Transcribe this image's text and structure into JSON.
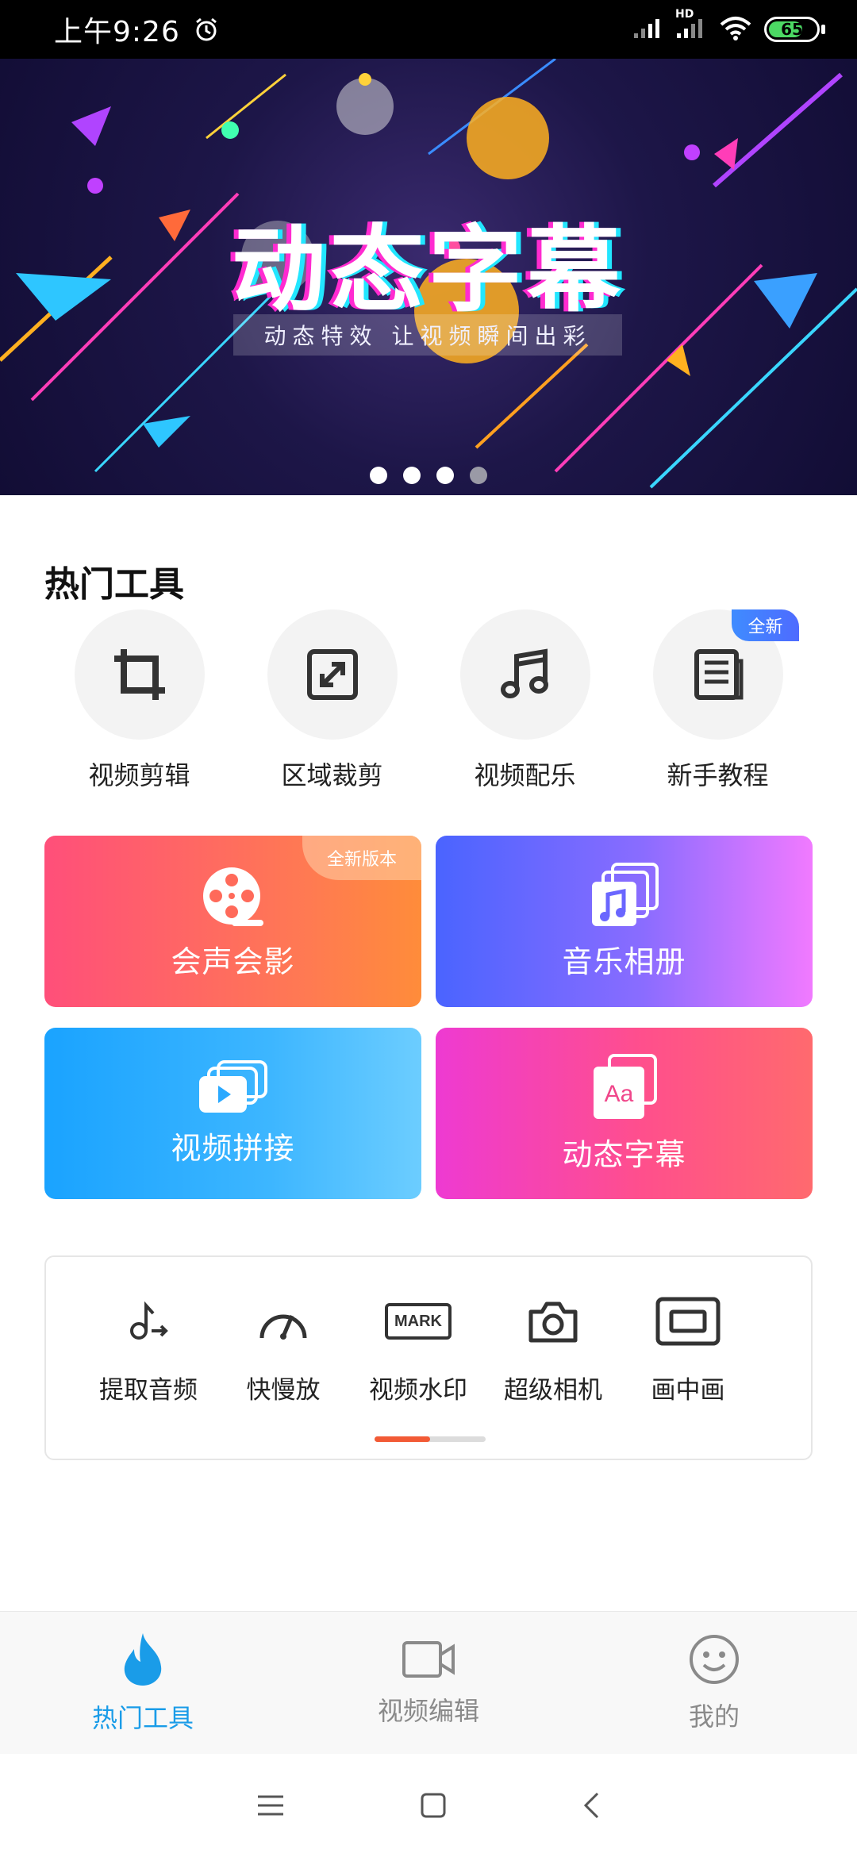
{
  "status_bar": {
    "time": "上午9:26",
    "network_label": "HD",
    "battery": "65"
  },
  "banner": {
    "title": "动态字幕",
    "subtitle": "动态特效 让视频瞬间出彩",
    "dots_total": 4,
    "active_dot": 1
  },
  "hot_tools": {
    "title": "热门工具",
    "items": [
      {
        "label": "视频剪辑",
        "icon": "crop-icon"
      },
      {
        "label": "区域裁剪",
        "icon": "expand-icon"
      },
      {
        "label": "视频配乐",
        "icon": "music-note-icon"
      },
      {
        "label": "新手教程",
        "icon": "document-icon",
        "badge": "全新"
      }
    ]
  },
  "feature_cards": [
    {
      "label": "会声会影",
      "icon": "film-reel-icon",
      "badge": "全新版本",
      "color_start": "#ff4f7a",
      "color_end": "#ff8c3a"
    },
    {
      "label": "音乐相册",
      "icon": "music-album-icon",
      "color_start": "#4a64ff",
      "color_end": "#f17aff"
    },
    {
      "label": "视频拼接",
      "icon": "video-stack-icon",
      "color_start": "#1aa3ff",
      "color_end": "#6ccdff"
    },
    {
      "label": "动态字幕",
      "icon": "text-aa-icon",
      "color_start": "#ee3ad2",
      "color_end": "#ff6a6e"
    }
  ],
  "more_tools": {
    "items": [
      {
        "label": "提取音频",
        "icon": "audio-extract-icon"
      },
      {
        "label": "快慢放",
        "icon": "speedometer-icon"
      },
      {
        "label": "视频水印",
        "icon": "watermark-icon",
        "icon_text": "MARK"
      },
      {
        "label": "超级相机",
        "icon": "camera-icon"
      },
      {
        "label": "画中画",
        "icon": "picture-in-picture-icon"
      }
    ],
    "scroll_position": 0.5
  },
  "bottom_nav": {
    "items": [
      {
        "label": "热门工具",
        "icon": "flame-icon",
        "active": true
      },
      {
        "label": "视频编辑",
        "icon": "video-camera-icon",
        "active": false
      },
      {
        "label": "我的",
        "icon": "smiley-icon",
        "active": false
      }
    ]
  },
  "colors": {
    "accent": "#1a9ce8",
    "scroll_thumb": "#f25a35"
  }
}
